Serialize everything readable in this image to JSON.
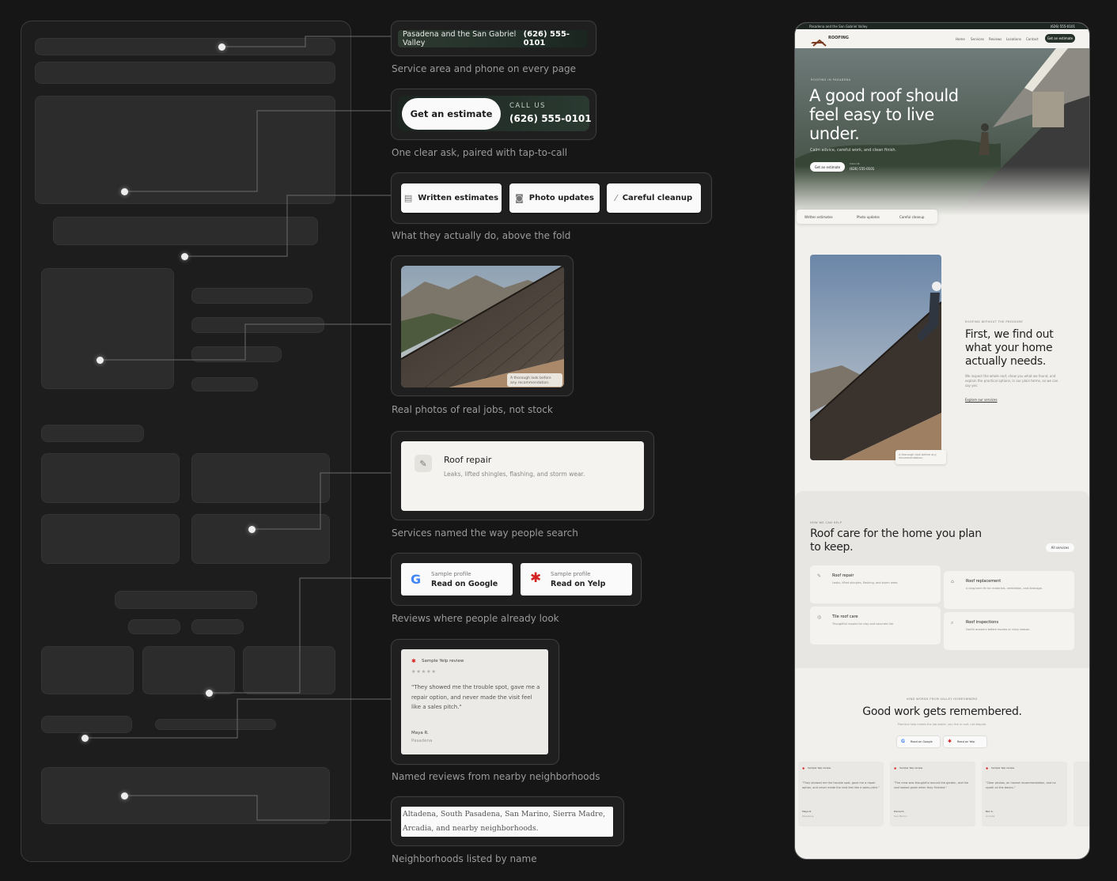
{
  "callouts": {
    "service_area": {
      "area_text": "Pasadena and the San Gabriel Valley",
      "phone": "(626) 555-0101",
      "caption": "Service area and phone on every page"
    },
    "cta": {
      "estimate_button": "Get an estimate",
      "call_label": "CALL US",
      "call_phone": "(626) 555-0101",
      "caption": "One clear ask, paired with tap-to-call"
    },
    "features": {
      "items": [
        "Written estimates",
        "Photo updates",
        "Careful cleanup"
      ],
      "caption": "What they actually do, above the fold"
    },
    "photo": {
      "overlay_text": "A thorough look before any recommendation.",
      "caption": "Real photos of real jobs, not stock"
    },
    "service": {
      "title": "Roof repair",
      "description": "Leaks, lifted shingles, flashing, and storm wear.",
      "caption": "Services named the way people search"
    },
    "reviews_links": {
      "google": {
        "small": "Sample profile",
        "label": "Read on Google"
      },
      "yelp": {
        "small": "Sample profile",
        "label": "Read on Yelp"
      },
      "caption": "Reviews where people already look"
    },
    "review_card": {
      "source": "Sample Yelp review",
      "stars": "★★★★★",
      "quote": "\"They showed me the trouble spot, gave me a repair option, and never made the visit feel like a sales pitch.\"",
      "author": "Maya R.",
      "location": "Pasadena",
      "caption": "Named reviews from nearby neighborhoods"
    },
    "neighborhoods": {
      "text": "Altadena, South Pasadena, San Marino, Sierra Madre, Arcadia, and nearby neighborhoods.",
      "caption": "Neighborhoods listed by name"
    }
  },
  "phone_mock": {
    "topbar_left": "Pasadena and the San Gabriel Valley",
    "topbar_phone": "(626) 555-0101",
    "logo_text": "ROOFING",
    "nav": [
      "Home",
      "Services",
      "Reviews",
      "Locations",
      "Contact"
    ],
    "nav_cta": "Get an estimate",
    "hero": {
      "eyebrow": "ROOFING IN PASADENA",
      "headline": "A good roof should feel easy to live under.",
      "sub": "Calm advice, careful work, and clean finish.",
      "cta": "Get an estimate",
      "call_label": "CALL US",
      "call_phone": "(626) 555-0101",
      "chips": [
        "Written estimates",
        "Photo updates",
        "Careful cleanup"
      ]
    },
    "about": {
      "eyebrow": "ROOFING WITHOUT THE PRESSURE",
      "headline": "First, we find out what your home actually needs.",
      "body": "We inspect the whole roof, show you what we found, and explain the practical options, in our plain terms, so we can say yes.",
      "link": "Explore our services",
      "photo_caption": "A thorough look before any recommendation."
    },
    "services": {
      "eyebrow": "HOW WE CAN HELP",
      "headline": "Roof care for the home you plan to keep.",
      "all_button": "All services",
      "items": [
        {
          "title": "Roof repair",
          "desc": "Leaks, lifted shingles, flashing, and storm wear."
        },
        {
          "title": "Roof replacement",
          "desc": "A long-term fix for materials, ventilation, and drainage."
        },
        {
          "title": "Tile roof care",
          "desc": "Thoughtful repairs for clay and concrete tile."
        },
        {
          "title": "Roof inspections",
          "desc": "Useful answers before escrow or rainy season."
        }
      ]
    },
    "reviews": {
      "eyebrow": "KIND WORDS FROM VALLEY HOMEOWNERS",
      "headline": "Good work gets remembered.",
      "sub": "Practical help makes the job easier, you live in roof, not dispute.",
      "google": "Read on Google",
      "yelp": "Read on Yelp",
      "cards": [
        {
          "source": "Sample Yelp review",
          "quote": "\"They showed me the trouble spot, gave me a repair option, and never made the visit feel like a sales pitch.\"",
          "author": "Maya R.",
          "location": "Pasadena"
        },
        {
          "source": "Sample Yelp review",
          "quote": "\"The crew was thoughtful around the garden, and the roof looked great when they finished.\"",
          "author": "Daniel K.",
          "location": "San Marino"
        },
        {
          "source": "Sample Yelp review",
          "quote": "\"Clear photos, an honest recommendation, and no upsell on the basics.\"",
          "author": "Ben S.",
          "location": "Arcadia"
        }
      ]
    }
  },
  "colors": {
    "background": "#161616",
    "card": "#1f1f1f",
    "wire_block": "#2c2c2c",
    "dark_green": "#26312a",
    "yelp_red": "#d32323"
  },
  "icons": [
    "document-icon",
    "camera-icon",
    "broom-icon",
    "wrench-icon",
    "google-icon",
    "yelp-icon",
    "star-icon"
  ]
}
